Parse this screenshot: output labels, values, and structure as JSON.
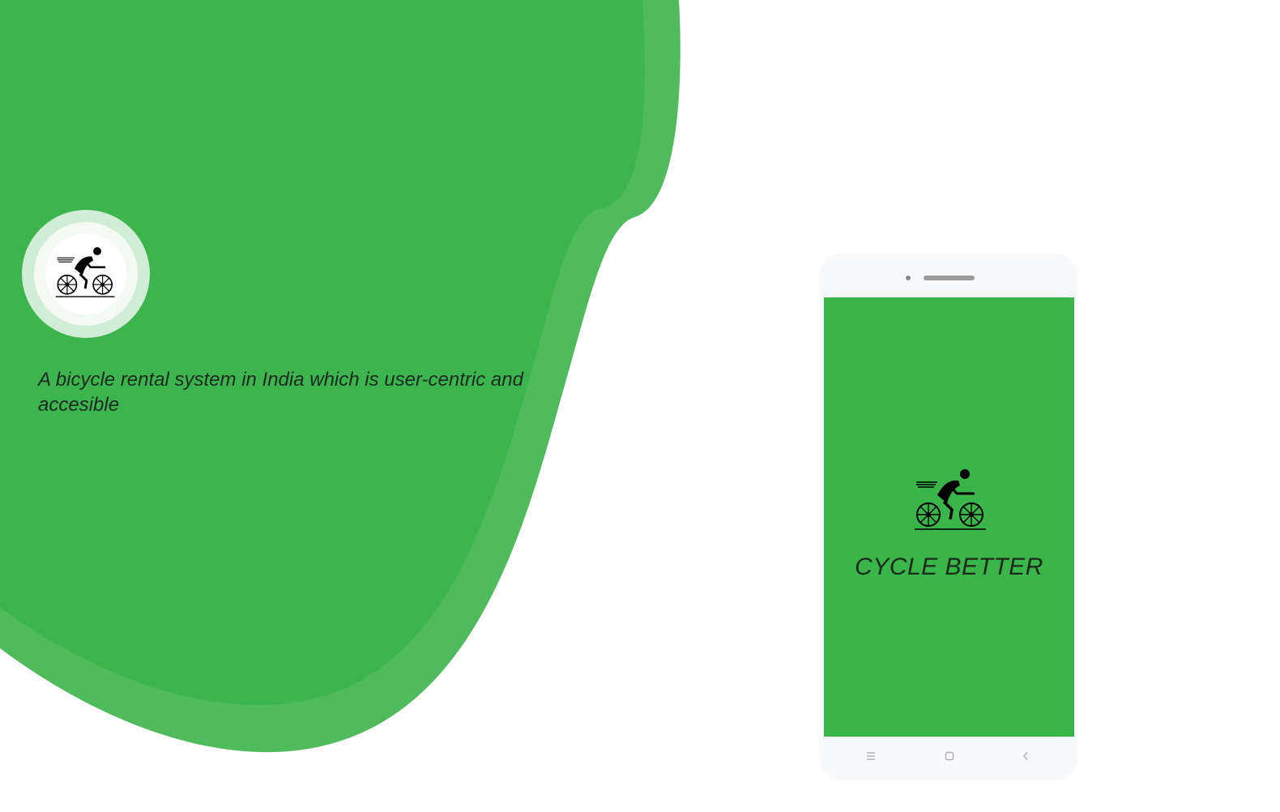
{
  "hero": {
    "tagline": "A bicycle rental system in India which is user-centric and accesible",
    "logo_icon": "cyclist-icon"
  },
  "phone": {
    "app_title": "CYCLE BETTER",
    "app_icon": "cyclist-icon",
    "nav": {
      "menu_icon": "menu-icon",
      "home_icon": "home-square-icon",
      "back_icon": "back-chevron-icon"
    }
  },
  "colors": {
    "green": "#3db54f",
    "green_light": "#4fbb5c",
    "screen": "#3ab54a"
  }
}
